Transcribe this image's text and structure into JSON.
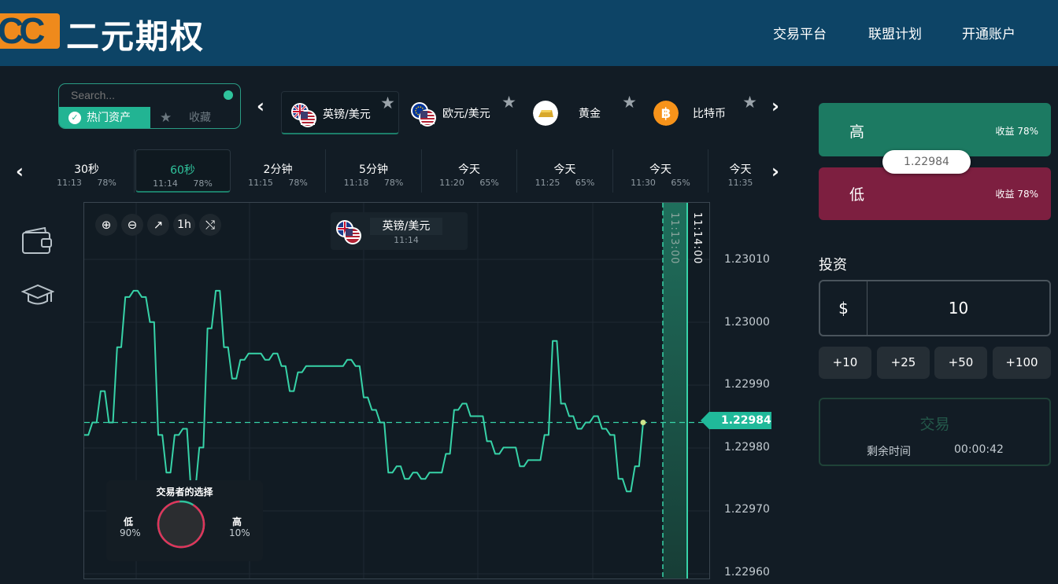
{
  "header": {
    "logo_mark": "CC",
    "logo_text": "二元期权",
    "nav": [
      "交易平台",
      "联盟计划",
      "开通账户"
    ]
  },
  "search": {
    "placeholder": "Search...",
    "tab_hot": "热门资产",
    "tab_fav": "收藏"
  },
  "assets": [
    {
      "name": "英镑/美元",
      "icon": "gbp-usd-flag-icon",
      "active": true
    },
    {
      "name": "欧元/美元",
      "icon": "eur-usd-flag-icon",
      "active": false
    },
    {
      "name": "黄金",
      "icon": "gold-bar-icon",
      "active": false
    },
    {
      "name": "比特币",
      "icon": "bitcoin-icon",
      "active": false
    }
  ],
  "expiries": [
    {
      "label": "30秒",
      "time": "11:13",
      "payout": "78%"
    },
    {
      "label": "60秒",
      "time": "11:14",
      "payout": "78%",
      "active": true
    },
    {
      "label": "2分钟",
      "time": "11:15",
      "payout": "78%"
    },
    {
      "label": "5分钟",
      "time": "11:18",
      "payout": "78%"
    },
    {
      "label": "今天",
      "time": "11:20",
      "payout": "65%"
    },
    {
      "label": "今天",
      "time": "11:25",
      "payout": "65%"
    },
    {
      "label": "今天",
      "time": "11:30",
      "payout": "65%"
    },
    {
      "label": "今天",
      "time": "11:35",
      "payout": ""
    }
  ],
  "chart": {
    "asset_name": "英镑/美元",
    "expiry_time": "11:14",
    "zoom_level": "1h",
    "vertical_labels": [
      "11:13:00",
      "11:14:00"
    ],
    "current_price": "1.22984",
    "y_ticks": [
      "1.23010",
      "1.23000",
      "1.22990",
      "1.22980",
      "1.22970",
      "1.22960"
    ]
  },
  "chart_data": {
    "type": "line",
    "title": "",
    "xlabel": "",
    "ylabel": "",
    "ylim": [
      1.2296,
      1.2301
    ],
    "series": [
      {
        "name": "",
        "color": "#37d3a8",
        "values": [
          1.22982,
          1.22984,
          1.22989,
          1.22984,
          1.22996,
          1.23004,
          1.23005,
          1.23004,
          1.23,
          1.22982,
          1.22976,
          1.22982,
          1.22983,
          1.22973,
          1.2298,
          1.22999,
          1.23005,
          1.22996,
          1.22991,
          1.22994,
          1.22995,
          1.22995,
          1.22994,
          1.22995,
          1.22993,
          1.22989,
          1.22992,
          1.22993,
          1.22993,
          1.22993,
          1.22993,
          1.22993,
          1.22994,
          1.22993,
          1.22988,
          1.22986,
          1.22984,
          1.22976,
          1.22977,
          1.22975,
          1.22976,
          1.22975,
          1.22976,
          1.22976,
          1.22979,
          1.22986,
          1.22987,
          1.22985,
          1.22985,
          1.22981,
          1.22979,
          1.2298,
          1.2298,
          1.22977,
          1.22978,
          1.22978,
          1.22982,
          1.22997,
          1.22987,
          1.22985,
          1.22983,
          1.22984,
          1.22985,
          1.22983,
          1.22982,
          1.22975,
          1.22973,
          1.22977,
          1.22984
        ]
      }
    ]
  },
  "sentiment": {
    "title": "交易者的选择",
    "low_label": "低",
    "low_pct": "90%",
    "high_label": "高",
    "high_pct": "10%",
    "low_fraction": 0.9
  },
  "trade": {
    "high_label": "高",
    "high_payout": "收益 78%",
    "low_label": "低",
    "low_payout": "收益 78%",
    "price_pill": "1.22984",
    "invest_title": "投资",
    "currency": "$",
    "amount": "10",
    "quick_adds": [
      "+10",
      "+25",
      "+50",
      "+100"
    ],
    "trade_button": "交易",
    "remaining_label": "剩余时间",
    "remaining_time": "00:00:42"
  },
  "colors": {
    "header_bg": "#0d4466",
    "accent_green": "#22b493",
    "line": "#37d3a8",
    "high": "#1c7a62",
    "low": "#7d1f40",
    "logo_orange": "#ef8a1c"
  }
}
